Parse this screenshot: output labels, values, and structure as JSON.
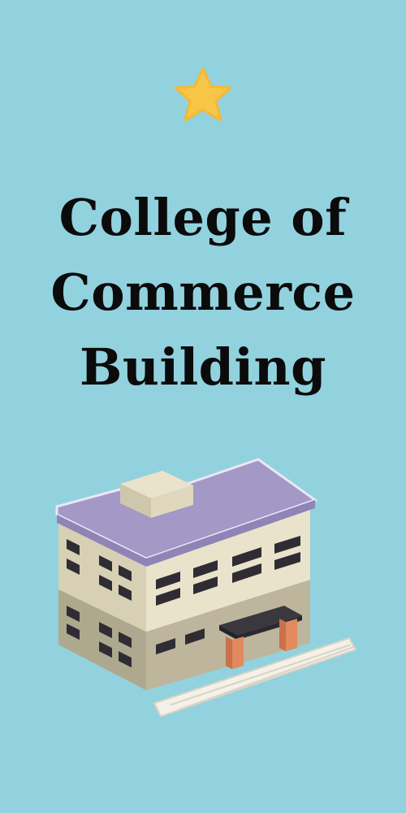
{
  "icon": "star-icon",
  "title_lines": [
    "College of",
    "Commerce",
    "Building"
  ],
  "illustration": "building-icon",
  "colors": {
    "background": "#92d2df",
    "star": "#f7c646",
    "title": "#0b0b0b",
    "roof": "#a398c6",
    "wall": "#eae3cb",
    "base": "#bdb69d",
    "window": "#2f2d33",
    "door_pillar": "#e2895e"
  }
}
